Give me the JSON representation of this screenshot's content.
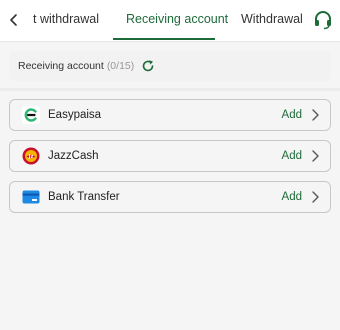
{
  "header": {
    "tabs": [
      {
        "label": "t withdrawal"
      },
      {
        "label": "Receiving account"
      },
      {
        "label": "Withdrawal I"
      }
    ],
    "active_tab_index": 1,
    "accent_color": "#1e6b3a"
  },
  "summary": {
    "label": "Receiving account",
    "count": "(0/15)"
  },
  "methods": [
    {
      "name": "Easypaisa",
      "action": "Add",
      "icon": "easypaisa-logo-icon"
    },
    {
      "name": "JazzCash",
      "action": "Add",
      "icon": "jazzcash-logo-icon"
    },
    {
      "name": "Bank Transfer",
      "action": "Add",
      "icon": "bank-card-icon"
    }
  ],
  "colors": {
    "accent": "#1e6b3a",
    "easypaisa": "#2bb673",
    "jazzcash": "#c8102e",
    "bank": "#1e88e5"
  }
}
